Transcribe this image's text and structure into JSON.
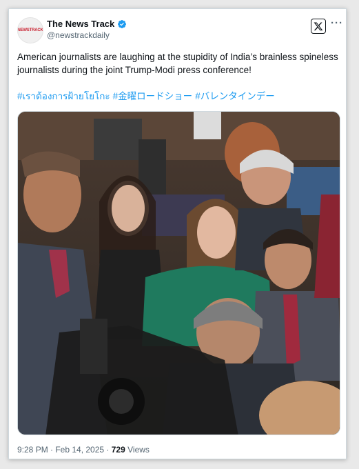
{
  "account": {
    "display_name": "The News Track",
    "handle": "@newstrackdaily",
    "avatar_text": "NEWSTRACK",
    "verified": true,
    "verified_color": "#1d9bf0"
  },
  "header_actions": {
    "x_logo_icon": "x-logo-icon",
    "more_icon": "more-options-icon",
    "more_glyph": "···"
  },
  "tweet": {
    "text": "American journalists are laughing at the stupidity of India’s brainless spineless journalists during the joint Trump-Modi press conference!",
    "hashtags": [
      "#เราต้องการฝ้ายโยโกะ",
      "#金曜ロードショー",
      "#バレンタインデー"
    ],
    "hashtag_color": "#1d9bf0"
  },
  "media": {
    "type": "video-still",
    "description_icon": "press-conference-photo"
  },
  "meta": {
    "time_date": "9:28 PM · Feb 14, 2025 · ",
    "views_count": "729",
    "views_label": " Views"
  }
}
